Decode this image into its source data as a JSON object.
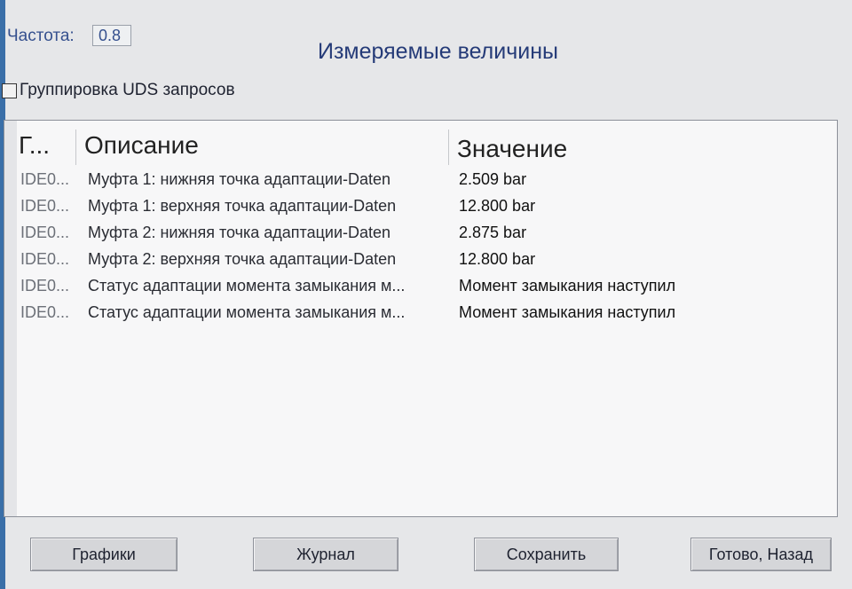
{
  "frequency": {
    "label": "Частота:",
    "value": "0.8"
  },
  "window_title": "Измеряемые величины",
  "uds_grouping": {
    "label": "Группировка UDS запросов",
    "checked": false
  },
  "table": {
    "columns": [
      "Г...",
      "Описание",
      "Значение"
    ],
    "rows": [
      {
        "id": "IDE0...",
        "description": "Муфта 1: нижняя точка адаптации-Daten",
        "value": "2.509 bar"
      },
      {
        "id": "IDE0...",
        "description": "Муфта 1: верхняя точка адаптации-Daten",
        "value": "12.800 bar"
      },
      {
        "id": "IDE0...",
        "description": "Муфта 2: нижняя точка адаптации-Daten",
        "value": "2.875 bar"
      },
      {
        "id": "IDE0...",
        "description": "Муфта 2: верхняя точка адаптации-Daten",
        "value": "12.800 bar"
      },
      {
        "id": "IDE0...",
        "description": "Статус адаптации момента замыкания м...",
        "value": "Момент замыкания наступил"
      },
      {
        "id": "IDE0...",
        "description": "Статус адаптации момента замыкания м...",
        "value": "Момент замыкания наступил"
      }
    ]
  },
  "buttons": {
    "graphs": "Графики",
    "log": "Журнал",
    "save": "Сохранить",
    "done_back": "Готово, Назад"
  },
  "colors": {
    "title_text": "#253b78",
    "label_text": "#35508e",
    "window_bg": "#e6e7e9",
    "list_bg": "#f7f7f8"
  }
}
